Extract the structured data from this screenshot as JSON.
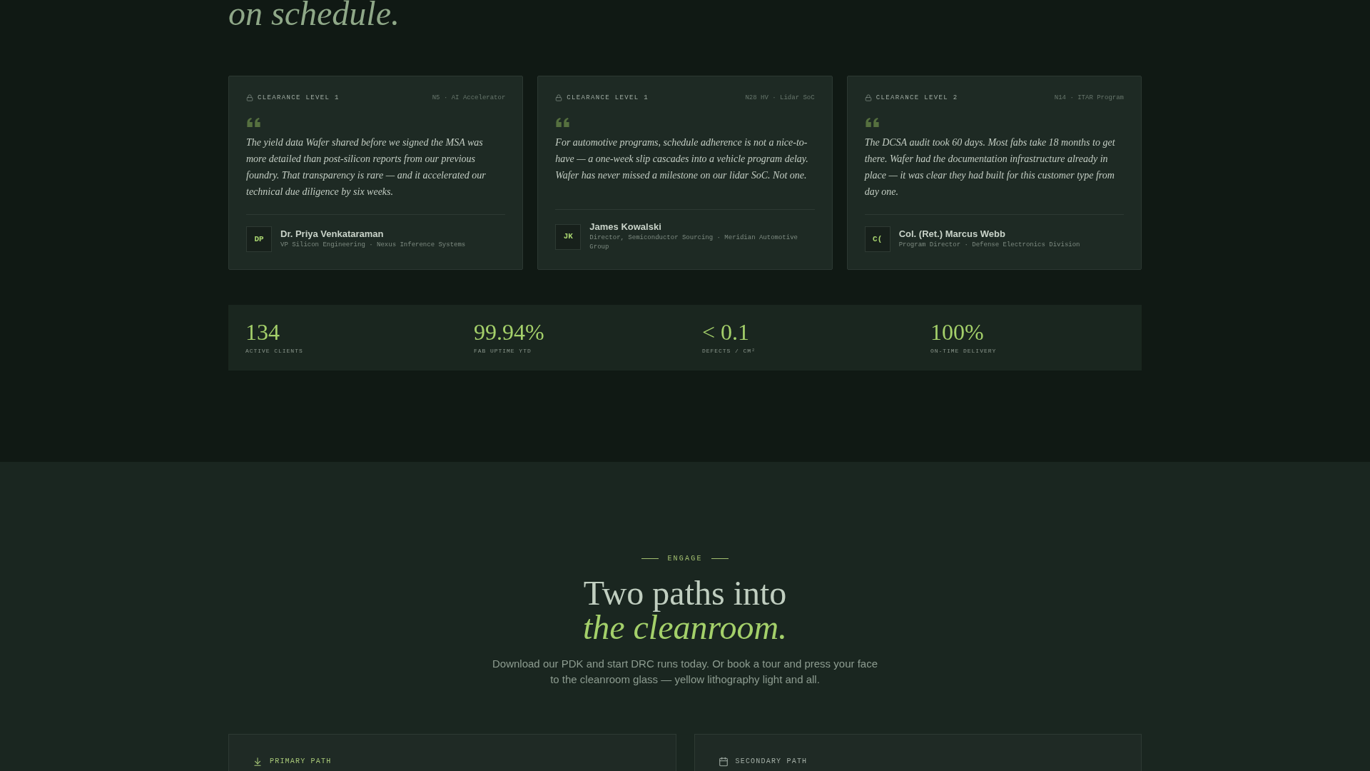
{
  "heading_fragment": "on schedule.",
  "testimonials": [
    {
      "clearance": "CLEARANCE LEVEL 1",
      "program": "N5 · AI Accelerator",
      "quote": "The yield data Wafer shared before we signed the MSA was more detailed than post-silicon reports from our previous foundry. That transparency is rare — and it accelerated our technical due diligence by six weeks.",
      "initials": "DP",
      "name": "Dr. Priya Venkataraman",
      "role": "VP Silicon Engineering · Nexus Inference Systems"
    },
    {
      "clearance": "CLEARANCE LEVEL 1",
      "program": "N28 HV · Lidar SoC",
      "quote": "For automotive programs, schedule adherence is not a nice-to-have — a one-week slip cascades into a vehicle program delay. Wafer has never missed a milestone on our lidar SoC. Not one.",
      "initials": "JK",
      "name": "James Kowalski",
      "role": "Director, Semiconductor Sourcing · Meridian Automotive Group"
    },
    {
      "clearance": "CLEARANCE LEVEL 2",
      "program": "N14 · ITAR Program",
      "quote": "The DCSA audit took 60 days. Most fabs take 18 months to get there. Wafer had the documentation infrastructure already in place — it was clear they had built for this customer type from day one.",
      "initials": "C(",
      "name": "Col. (Ret.) Marcus Webb",
      "role": "Program Director · Defense Electronics Division"
    }
  ],
  "stats": [
    {
      "value": "134",
      "label": "ACTIVE CLIENTS"
    },
    {
      "value": "99.94%",
      "label": "FAB UPTIME YTD"
    },
    {
      "value": "< 0.1",
      "label": "DEFECTS / CM²"
    },
    {
      "value": "100%",
      "label": "ON-TIME DELIVERY"
    }
  ],
  "engage": {
    "eyebrow": "ENGAGE",
    "title": "Two paths into",
    "title_emphasis": "the cleanroom.",
    "description": "Download our PDK and start DRC runs today. Or book a tour and press your face to the cleanroom glass — yellow lithography light and all."
  },
  "paths": [
    {
      "kind": "primary",
      "label": "PRIMARY PATH"
    },
    {
      "kind": "secondary",
      "label": "SECONDARY PATH"
    }
  ]
}
